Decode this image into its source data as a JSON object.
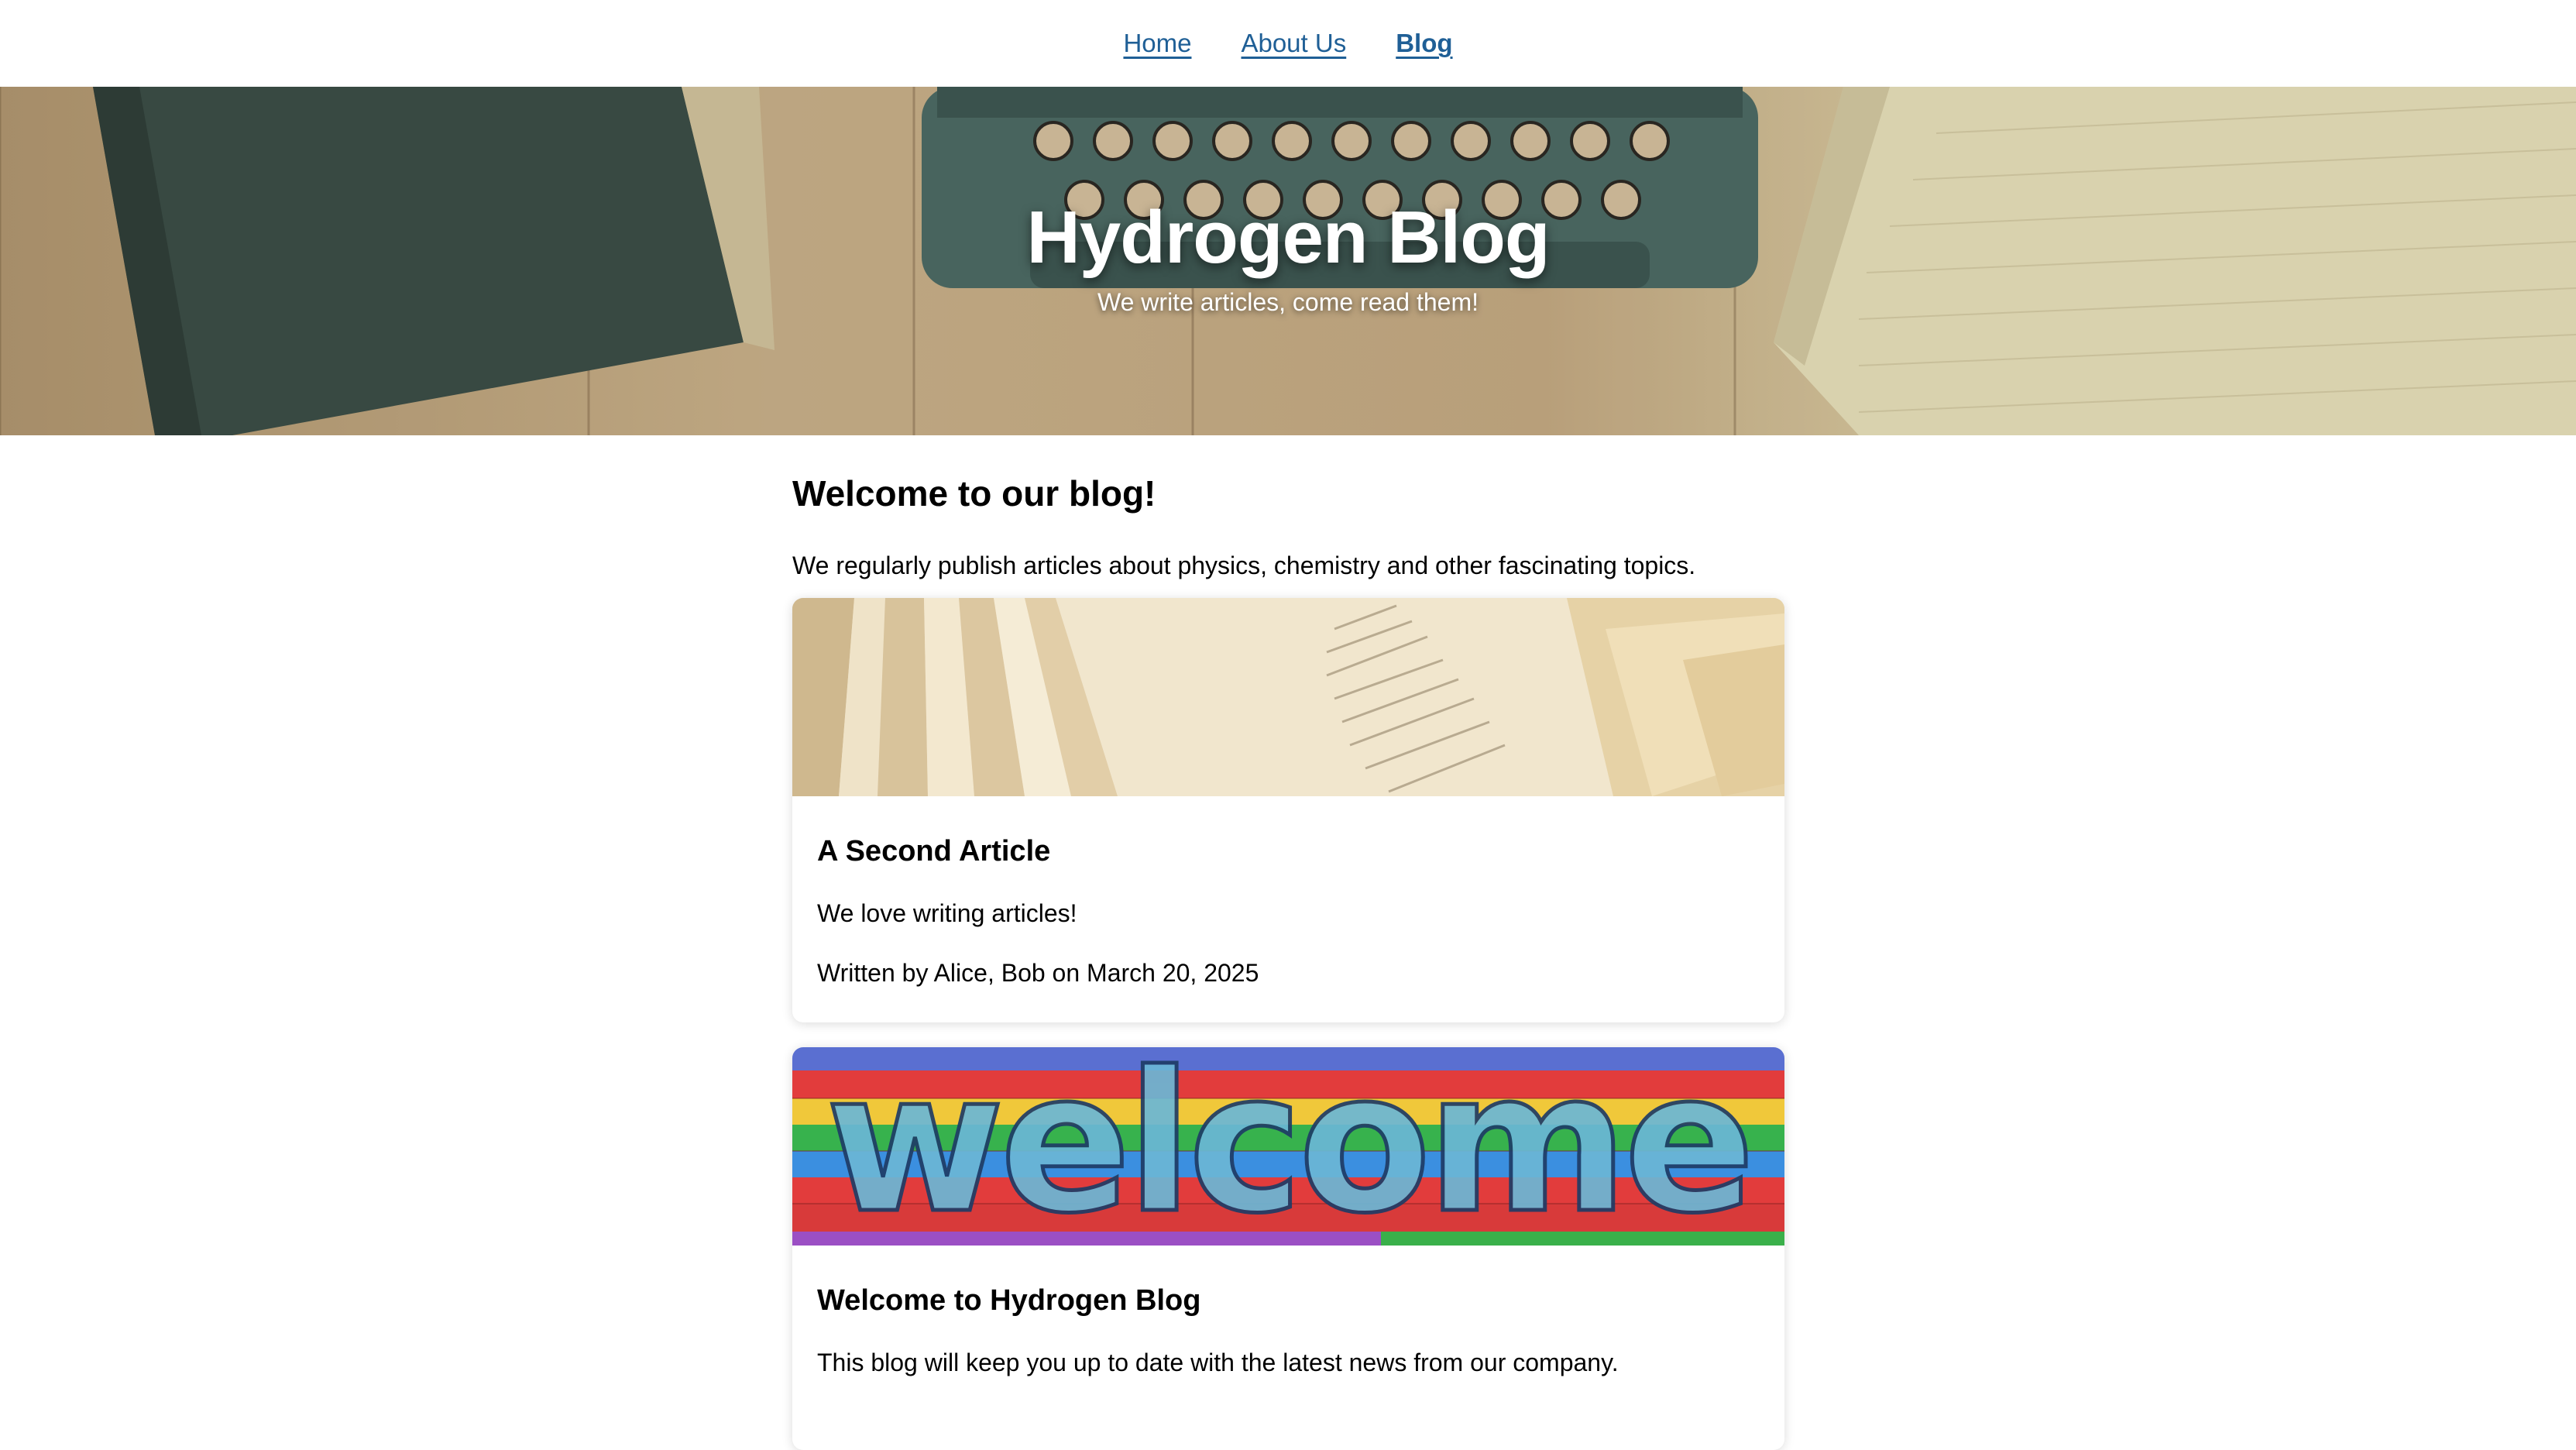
{
  "nav": {
    "items": [
      {
        "label": "Home",
        "active": false
      },
      {
        "label": "About Us",
        "active": false
      },
      {
        "label": "Blog",
        "active": true
      }
    ],
    "link_color": "#1f5f96"
  },
  "hero": {
    "title": "Hydrogen Blog",
    "subtitle": "We write articles, come read them!"
  },
  "main": {
    "heading": "Welcome to our blog!",
    "intro": "We regularly publish articles about physics, chemistry and other fascinating topics."
  },
  "articles": [
    {
      "title": "A Second Article",
      "description": "We love writing articles!",
      "meta": "Written by Alice, Bob on March 20, 2025",
      "image": "open-book-pages-photo"
    },
    {
      "title": "Welcome to Hydrogen Blog",
      "description": "This blog will keep you up to date with the latest news from our company.",
      "image": "colorful-welcome-letters-photo"
    }
  ]
}
